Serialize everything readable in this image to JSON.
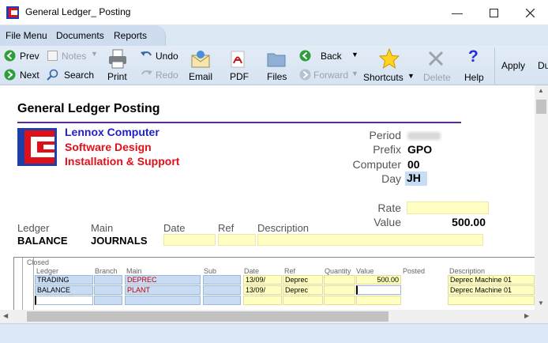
{
  "window": {
    "title": "General Ledger_ Posting"
  },
  "menu": [
    "File Menu",
    "Documents",
    "Reports"
  ],
  "toolbar": {
    "prev": "Prev",
    "next": "Next",
    "notes": "Notes",
    "search": "Search",
    "print": "Print",
    "undo": "Undo",
    "redo": "Redo",
    "email": "Email",
    "pdf": "PDF",
    "files": "Files",
    "back": "Back",
    "forward": "Forward",
    "shortcuts": "Shortcuts",
    "delete": "Delete",
    "help": "Help",
    "apply": "Apply",
    "du": "Du"
  },
  "document": {
    "title": "General Ledger Posting",
    "company": [
      "Lennox Computer",
      "Software Design",
      "Installation & Support"
    ],
    "fields": {
      "period_label": "Period",
      "prefix_label": "Prefix",
      "prefix_value": "GPO",
      "computer_label": "Computer",
      "computer_value": "00",
      "day_label": "Day",
      "day_value": "JH",
      "rate_label": "Rate",
      "value_label": "Value",
      "value_value": "500.00"
    },
    "header_labels": {
      "ledger": "Ledger",
      "main": "Main",
      "date": "Date",
      "ref": "Ref",
      "description": "Description"
    },
    "header_values": {
      "ledger": "BALANCE",
      "main": "JOURNALS"
    }
  },
  "grid": {
    "closed_label": "Closed",
    "columns": [
      "Ledger",
      "Branch",
      "Main",
      "Sub",
      "Date",
      "Ref",
      "Quantity",
      "Value",
      "Posted",
      "Description"
    ],
    "rows": [
      {
        "ledger": "TRADING",
        "main": "DEPREC",
        "date": "13/09/",
        "ref": "Deprec",
        "value": "500.00",
        "description": "Deprec Machine 01"
      },
      {
        "ledger": "BALANCE",
        "main": "PLANT",
        "date": "13/09/",
        "ref": "Deprec",
        "value": "",
        "description": "Deprec Machine 01"
      }
    ]
  },
  "colors": {
    "accent": "#5b2d8a",
    "company_blue": "#1f1fc8",
    "company_red": "#e0101a",
    "field_yellow": "#ffffc4"
  }
}
